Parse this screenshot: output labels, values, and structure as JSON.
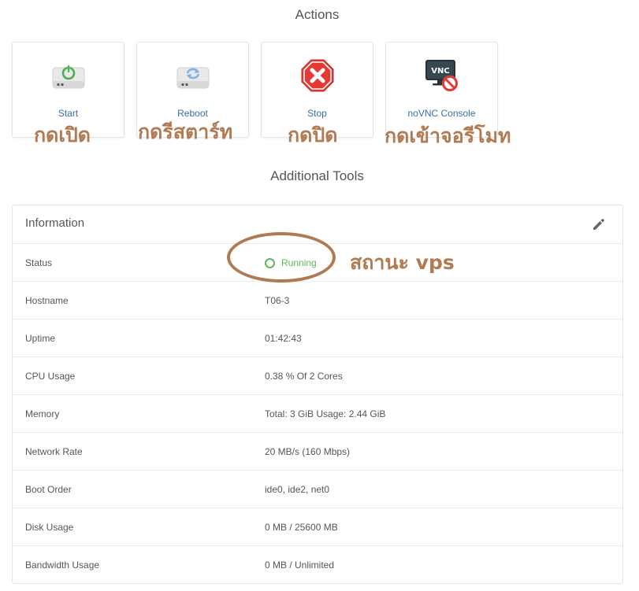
{
  "actions": {
    "title": "Actions",
    "items": [
      {
        "label": "Start",
        "icon": "power-drive-icon",
        "note": "กดเปิด"
      },
      {
        "label": "Reboot",
        "icon": "refresh-drive-icon",
        "note": "กดรีสตาร์ท"
      },
      {
        "label": "Stop",
        "icon": "stop-sign-icon",
        "note": "กดปิด"
      },
      {
        "label": "noVNC Console",
        "icon": "vnc-console-icon",
        "note": "กดเข้าจอรีโมท"
      }
    ]
  },
  "tools": {
    "title": "Additional Tools"
  },
  "information": {
    "title": "Information",
    "status_note": "สถานะ vps",
    "rows": [
      {
        "key": "Status",
        "value": "Running"
      },
      {
        "key": "Hostname",
        "value": "T06-3"
      },
      {
        "key": "Uptime",
        "value": "01:42:43"
      },
      {
        "key": "CPU Usage",
        "value": "0.38 % Of 2 Cores"
      },
      {
        "key": "Memory",
        "value": "Total: 3 GiB Usage: 2.44 GiB"
      },
      {
        "key": "Network Rate",
        "value": "20 MB/s (160 Mbps)"
      },
      {
        "key": "Boot Order",
        "value": "ide0, ide2, net0"
      },
      {
        "key": "Disk Usage",
        "value": "0 MB / 25600 MB"
      },
      {
        "key": "Bandwidth Usage",
        "value": "0 MB / Unlimited"
      }
    ]
  },
  "colors": {
    "link": "#3a6ea5",
    "running": "#5cb85c",
    "annotation": "#b07a52",
    "stop": "#e53935"
  }
}
